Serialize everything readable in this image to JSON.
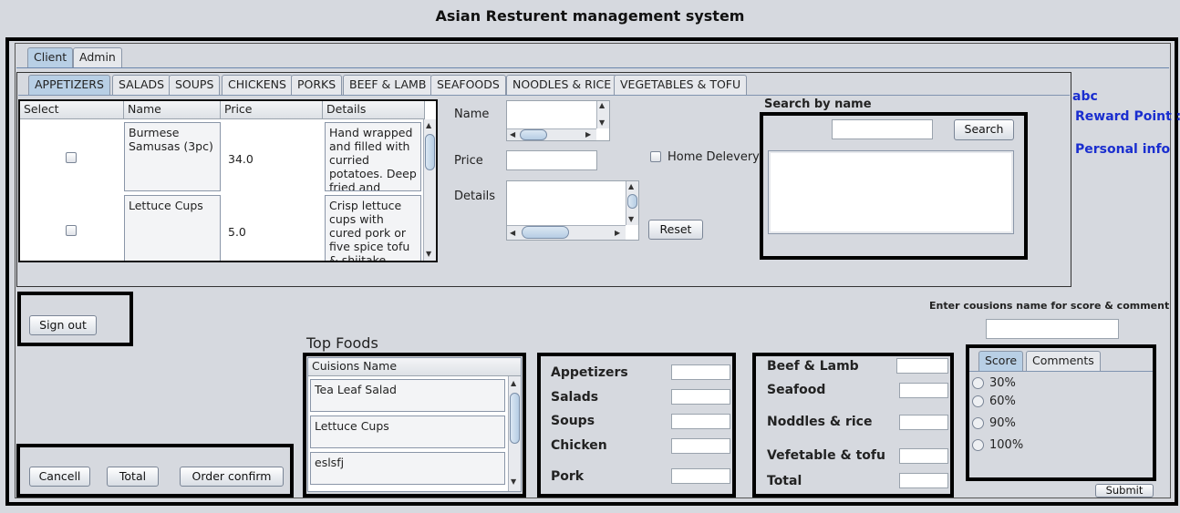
{
  "window": {
    "title": "Asian Resturent management system"
  },
  "top_tabs": [
    {
      "label": "Client",
      "active": true
    },
    {
      "label": "Admin",
      "active": false
    }
  ],
  "category_tabs": [
    {
      "label": "APPETIZERS",
      "active": true
    },
    {
      "label": "SALADS"
    },
    {
      "label": "SOUPS"
    },
    {
      "label": "CHICKENS"
    },
    {
      "label": "PORKS"
    },
    {
      "label": "BEEF & LAMB"
    },
    {
      "label": "SEAFOODS"
    },
    {
      "label": "NOODLES & RICE"
    },
    {
      "label": "VEGETABLES & TOFU"
    }
  ],
  "menu_table": {
    "columns": [
      "Select",
      "Name",
      "Price",
      "Details"
    ],
    "rows": [
      {
        "name": "Burmese Samusas (3pc)",
        "price": "34.0",
        "details": "Hand wrapped and filled with curried potatoes. Deep fried and"
      },
      {
        "name": "Lettuce Cups",
        "price": "5.0",
        "details": "Crisp lettuce cups with cured pork or five spice tofu & shiitake"
      }
    ]
  },
  "item_form": {
    "name_label": "Name",
    "price_label": "Price",
    "details_label": "Details",
    "home_delivery_label": "Home Delevery",
    "reset_label": "Reset"
  },
  "search": {
    "heading": "Search by name",
    "button_label": "Search",
    "input_value": ""
  },
  "side_links": {
    "user": "abc",
    "reward": "Reward Point :",
    "personal": "Personal info"
  },
  "sign_out_label": "Sign out",
  "order_buttons": {
    "cancel": "Cancell",
    "total": "Total",
    "confirm": "Order confirm"
  },
  "top_foods": {
    "heading": "Top Foods",
    "column": "Cuisions Name",
    "items": [
      "Tea Leaf Salad",
      "Lettuce Cups",
      "eslsfj"
    ]
  },
  "totals_left": [
    "Appetizers",
    "Salads",
    "Soups",
    "Chicken",
    "Pork"
  ],
  "totals_right": [
    "Beef & Lamb",
    "Seafood",
    "Noddles & rice",
    "Vefetable & tofu",
    "Total"
  ],
  "rating": {
    "prompt": "Enter cousions name for score & comment",
    "tabs": [
      {
        "label": "Score",
        "active": true
      },
      {
        "label": "Comments"
      }
    ],
    "options": [
      "30%",
      "60%",
      "90%",
      "100%"
    ],
    "submit_label": "Submit"
  }
}
